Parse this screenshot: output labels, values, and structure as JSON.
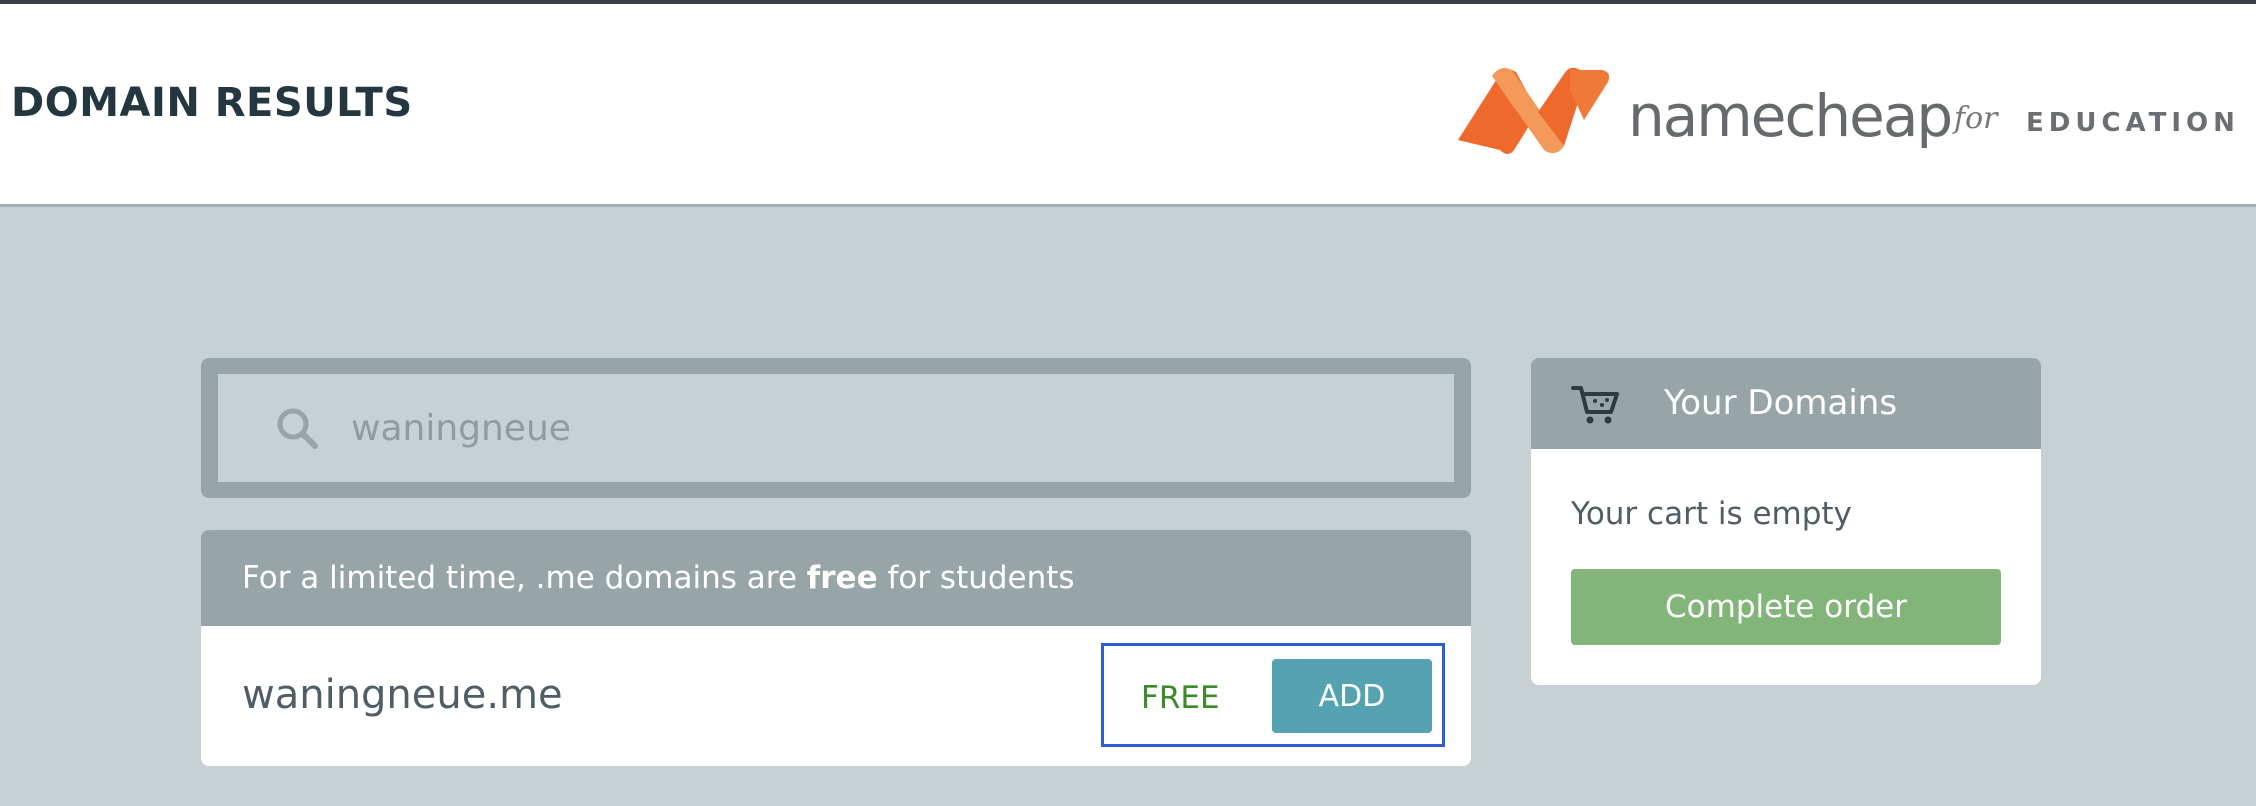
{
  "header": {
    "title": "DOMAIN RESULTS",
    "logo": {
      "word": "namecheap",
      "for": "for",
      "education": "EDUCATION"
    }
  },
  "search": {
    "value": "waningneue",
    "icon": "search-icon"
  },
  "results": {
    "promo_prefix": "For a limited time, .me domains are ",
    "promo_bold": "free",
    "promo_suffix": " for students",
    "items": [
      {
        "domain": "waningneue.me",
        "price": "FREE",
        "add_label": "ADD"
      }
    ]
  },
  "cart": {
    "icon": "cart-icon",
    "title": "Your Domains",
    "empty_text": "Your cart is empty",
    "complete_label": "Complete order"
  },
  "colors": {
    "background": "#c7d0d2",
    "panel_header": "#97a5a8",
    "add_button": "#55a3b1",
    "complete_button": "#83b57a",
    "free_text": "#3b8a2a",
    "logo_orange": "#ee6a2c",
    "highlight_border": "#2d5fd0"
  }
}
